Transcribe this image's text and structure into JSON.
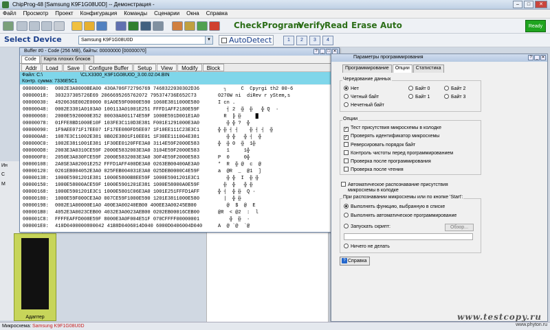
{
  "app": {
    "title": "ChipProg-48 [Samsung  K9F1G08U0D] -- Демонстрация -"
  },
  "menu": [
    "Файл",
    "Просмотр",
    "Проект",
    "Конфигурация",
    "Команды",
    "Сценарии",
    "Окна",
    "Справка"
  ],
  "commands": {
    "check": "Check",
    "program": "Program",
    "verify": "Verify",
    "read": "Read",
    "erase": "Erase",
    "auto": "Auto"
  },
  "ready": "Ready",
  "select_device": "Select Device",
  "device": "Samsung K9F1G08U0D",
  "autodetect": "AutoDetect",
  "sockets": [
    "1",
    "2",
    "3",
    "4"
  ],
  "left_panel": [
    "Ин",
    "С",
    "М"
  ],
  "adapter": "Адаптер",
  "buffer": {
    "title": "Buffer #0 - Code (256 MB), байты: 00000000 [00000070]",
    "tabs": [
      "Code",
      "Карта плохих блоков"
    ],
    "buttons": [
      "Addr",
      "Load",
      "Save",
      "Configure Buffer",
      "Setup",
      "View",
      "Modify",
      "Block"
    ],
    "file_label": "Файл: C:\\",
    "file_path": "\\CLX3300_K9F1G08U0D_3.00.02.04.BIN",
    "checksum": "Контр. сумма: 7336E5C1",
    "rows": [
      {
        "off": "00000000:",
        "hex": "0002E3A0000BEA00 430A706F72796769 7468322030302D36",
        "asc": "  ┐     C  Cpyrgi th2 00-6"
      },
      {
        "off": "00000018:",
        "hex": "303237305726E69 2066695265762072 795374736E652C73",
        "asc": "0270W ni  diRev r yStem,s"
      },
      {
        "off": "00000030:",
        "hex": "4920636E002E0000 01A0E59F0000E590 1060E3811000E580",
        "asc": "I cn .        "
      },
      {
        "off": "00000048:",
        "hex": "0002E3301A0103A0 100113A01001E251 FFFD1AFF2180E59F",
        "asc": "   ┤ 2  ╬  ╬   ╬ Q  ·"
      },
      {
        "off": "00000060:",
        "hex": "2000E5920000E352 00030A001174E59F 1000E591D001E1A0",
        "asc": "  R  ╠ ╬     █"
      },
      {
        "off": "00000078:",
        "hex": "01FFE8BD1000E10F 103FE3C110D3E381 F001E1291000E3A0",
        "asc": "   ╬ ╬ ?  ╬    "
      },
      {
        "off": "00000090:",
        "hex": "1F9AEE071F17EE07 1F17EE080FD5EE07 1F10EE111C23E3C1",
        "asc": "╬ ╬ ┤ ┤    ╬ ┤ ┤  ╬"
      },
      {
        "off": "000000A8:",
        "hex": "1087E3C11002E381 0B02E3801F10EE01 1F30EE111004E381",
        "asc": "   ╬ ╬   ╬ ┤  ╬"
      },
      {
        "off": "000000C0:",
        "hex": "1002E3811001E381 1F30EE0120FFE3A0 3114E59F2000E583",
        "asc": "╬  ╬ 0  ╬  1╬"
      },
      {
        "off": "000000D8:",
        "hex": "2003E3A0310CE59F 2000E5832003E3A0 3104E59F2000E583",
        "asc": "   1     1╬"
      },
      {
        "off": "000000F0:",
        "hex": "2050E3A030FCE59F 2000E5832003E3A0 30F4E59F2000E583",
        "asc": "P  0     0╬"
      },
      {
        "off": "00000108:",
        "hex": "2A0SE3A02001E252 FFFD1AFF400DE3A0 0263EB00400AE3A0",
        "asc": "*  R  ╬ @  c  @"
      },
      {
        "off": "00000120:",
        "hex": "0261EB004052E3A0 025FEB004031E3A0 025DEB0000C4E59F",
        "asc": "a  @R  _  @1  ]"
      },
      {
        "off": "00000138:",
        "hex": "1000E5901201E381 1000E5800B8EE59F 1000E5901201E3C1",
        "asc": "   ╬ ╬  I  ╬ ╬"
      },
      {
        "off": "00000150:",
        "hex": "1000E58000ACE59F 1000E5901201E381 1000E58000A0E59F",
        "asc": "  ╬  ╬   ╬ ╬"
      },
      {
        "off": "00000168:",
        "hex": "1000E5901201E3C1 1000E5801C06E3A0 1001E251FFFD1AFF",
        "asc": "╬ ┤  ╬ ╬  Q ·"
      },
      {
        "off": "00000180:",
        "hex": "1000E59F000CE3A0 007CE59F1000E590 1201E3811000E580",
        "asc": "  |  ╬ ╬"
      },
      {
        "off": "00000198:",
        "hex": "0002E1A00000E1A0 400E3A00240EB00 400EE3A00245EB00",
        "asc": "   @  $  @  E"
      },
      {
        "off": "000001B0:",
        "hex": "4052E3A0023CEB00 4032E3A0023AEB00 0202EB00016CEB00",
        "asc": "@R  < @2  :  l"
      },
      {
        "off": "000001C8:",
        "hex": "FFFFEAFFD008E59F 8000E3A0F004E51F 070CFFFF00000001",
        "asc": "    ╬  ╬  ·"
      },
      {
        "off": "000001E0:",
        "hex": "410D0400000800042 41B8D0406014D040 6000D0406004D040",
        "asc": "A  @ `@  `@"
      }
    ]
  },
  "options": {
    "title": "Параметры программирования",
    "tabs": [
      "Программирование",
      "Опции",
      "Статистика"
    ],
    "interleave": {
      "label": "Чередование данных",
      "left": [
        "Нет",
        "Четный байт",
        "Нечетный байт"
      ],
      "right": [
        "Байт 0",
        "Байт 1",
        "Байт 2",
        "Байт 3"
      ]
    },
    "options_group": {
      "label": "Опции",
      "items": [
        {
          "text": "Тест присутствия микросхемы в колодке",
          "checked": true
        },
        {
          "text": "Проверять идентификатор микросхемы",
          "checked": true
        },
        {
          "text": "Реверсировать порядок байт",
          "checked": false
        },
        {
          "text": "Контроль чистоты перед программированием",
          "checked": false
        },
        {
          "text": "Проверка после программирования",
          "checked": false
        },
        {
          "text": "Проверка после чтения",
          "checked": false
        }
      ]
    },
    "auto_detect_line1": "Автоматическое распознавание присутствия",
    "auto_detect_line2": "микросхемы в колодке",
    "start_group": {
      "label": "При распознавании микросхемы или по кнопке 'Start':",
      "items": [
        "Выполнять функцию, выбранную в списке",
        "Выполнять автоматическое программирование",
        "Запускать скрипт:",
        "Ничего не делать"
      ]
    },
    "browse": "Обзор...",
    "help": "Справка"
  },
  "status": {
    "label": "Микросхема:",
    "value": "Samsung K9F1G08U0D"
  },
  "watermark": "www.testcopy.ru",
  "site": "www.phyton.ru"
}
